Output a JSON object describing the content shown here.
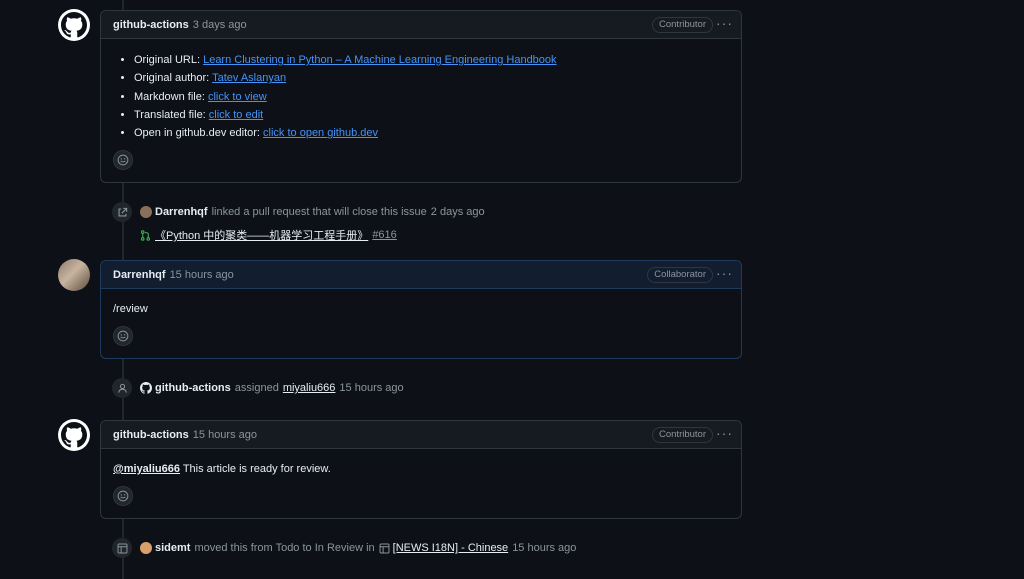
{
  "comments": [
    {
      "author": "github-actions",
      "time": "3 days ago",
      "role": "Contributor",
      "items": [
        {
          "label": "Original URL: ",
          "link": "Learn Clustering in Python – A Machine Learning Engineering Handbook"
        },
        {
          "label": "Original author: ",
          "link": "Tatev Aslanyan"
        },
        {
          "label": "Markdown file: ",
          "link": "click to view"
        },
        {
          "label": "Translated file: ",
          "link": "click to edit"
        },
        {
          "label": "Open in github.dev editor: ",
          "link": "click to open github.dev"
        }
      ]
    },
    {
      "author": "Darrenhqf",
      "time": "15 hours ago",
      "role": "Collaborator",
      "body": "/review"
    },
    {
      "author": "github-actions",
      "time": "15 hours ago",
      "role": "Contributor",
      "mention": "@miyaliu666",
      "body": " This article is ready for review."
    }
  ],
  "events": {
    "linked": {
      "actor": "Darrenhqf",
      "text": "linked a pull request that will close this issue",
      "time": "2 days ago",
      "pr_title": "《Python 中的聚类——机器学习工程手册》",
      "pr_number": "#616"
    },
    "assigned": {
      "actor": "github-actions",
      "text": "assigned",
      "assignee": "miyaliu666",
      "time": "15 hours ago"
    },
    "moved": {
      "actor": "sidemt",
      "text": "moved this from Todo to In Review in",
      "project": "[NEWS I18N] - Chinese",
      "time": "15 hours ago"
    }
  },
  "more_label": "···",
  "colors": {
    "background": "#0d1117",
    "link": "#4493f8",
    "pr_icon": "#3fb950",
    "highlight_border": "#1f3a5f"
  }
}
